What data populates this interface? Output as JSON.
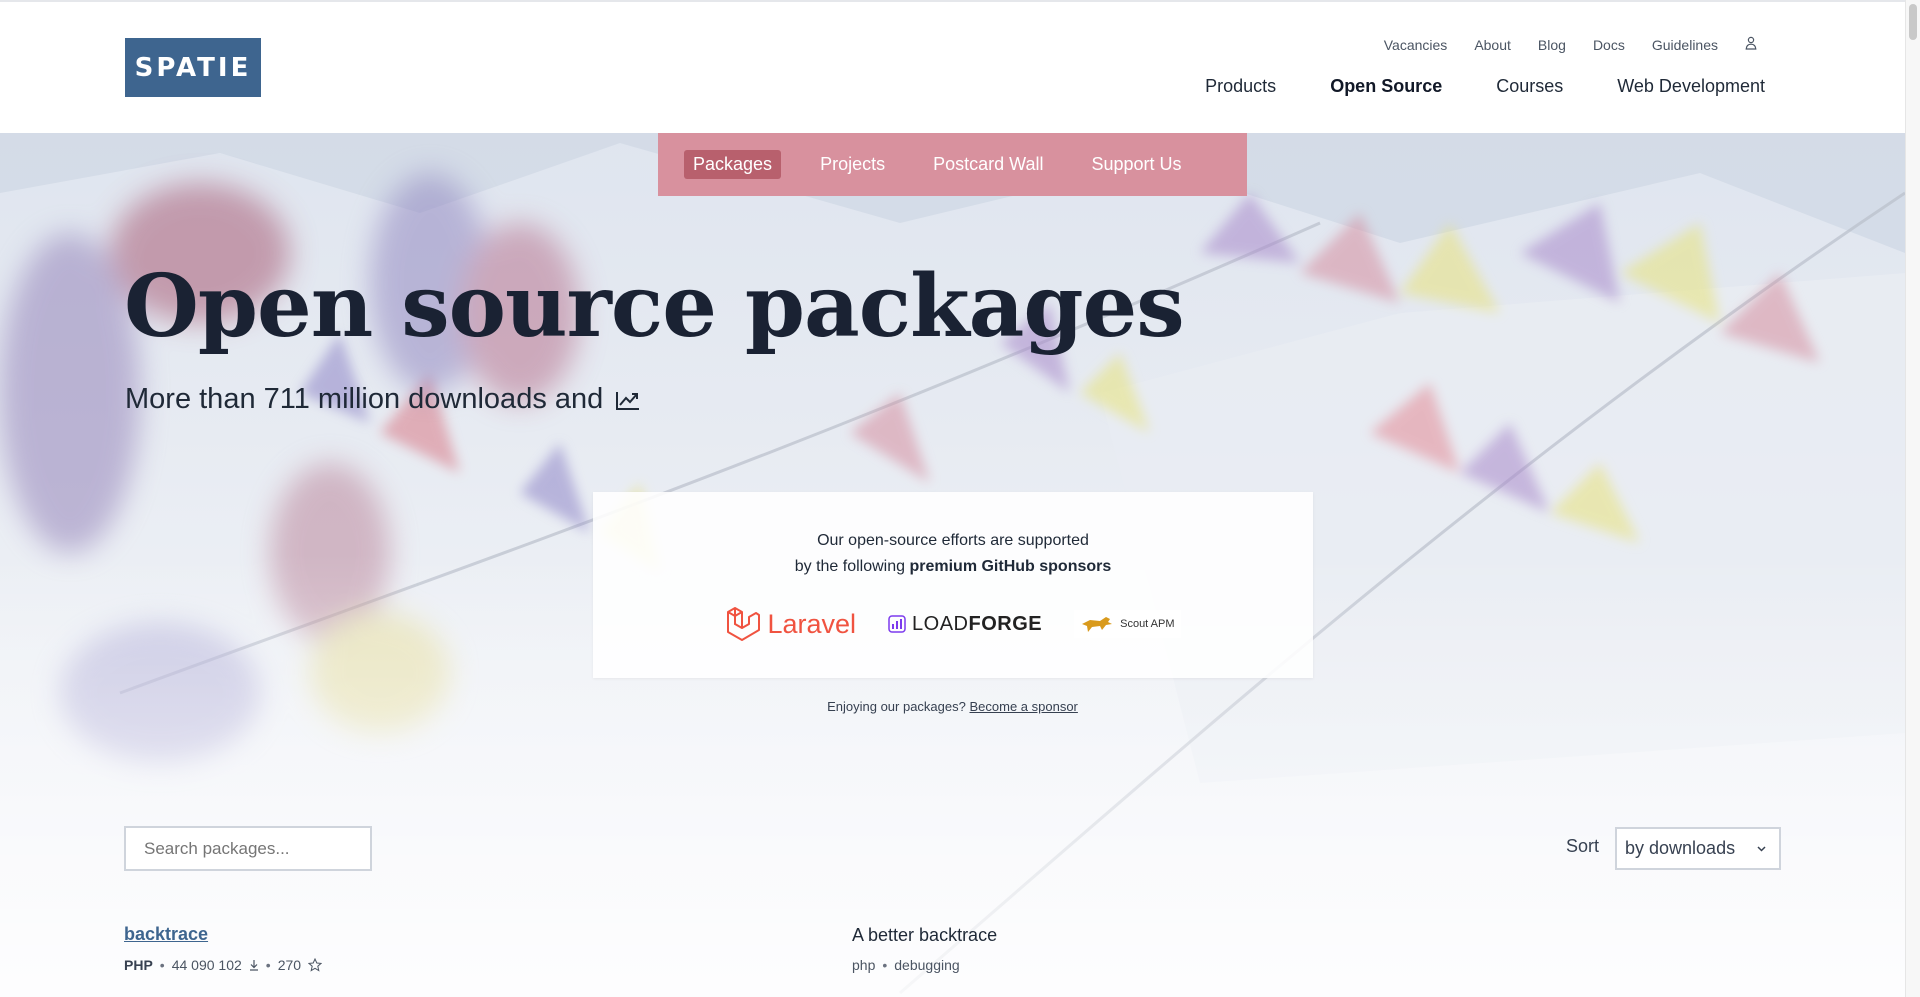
{
  "brand": {
    "logo_text": "SPATIE",
    "color": "#3e658f"
  },
  "utility_nav": {
    "items": [
      "Vacancies",
      "About",
      "Blog",
      "Docs",
      "Guidelines"
    ],
    "user_icon": "user-icon"
  },
  "main_nav": {
    "items": [
      "Products",
      "Open Source",
      "Courses",
      "Web Development"
    ],
    "active": "Open Source"
  },
  "sub_nav": {
    "items": [
      "Packages",
      "Projects",
      "Postcard Wall",
      "Support Us"
    ],
    "active": "Packages",
    "color": "#d8919e"
  },
  "hero": {
    "title": "Open source packages",
    "subtitle": "More than 711 million downloads and",
    "subtitle_icon": "trending-chart-icon"
  },
  "sponsors": {
    "line1": "Our open-source efforts are supported",
    "line2_prefix": "by the following",
    "line2_strong": "premium GitHub sponsors",
    "logos": {
      "laravel": "Laravel",
      "loadforge_light": "LOAD",
      "loadforge_bold": "FORGE",
      "scout": "Scout APM"
    },
    "enjoy_text": "Enjoying our packages?",
    "become_sponsor": "Become a sponsor"
  },
  "controls": {
    "search_placeholder": "Search packages...",
    "sort_label": "Sort",
    "sort_value": "by downloads"
  },
  "packages": [
    {
      "name": "backtrace",
      "language": "PHP",
      "downloads": "44 090 102",
      "stars": "270",
      "description": "A better backtrace",
      "tags": [
        "php",
        "debugging"
      ]
    }
  ]
}
